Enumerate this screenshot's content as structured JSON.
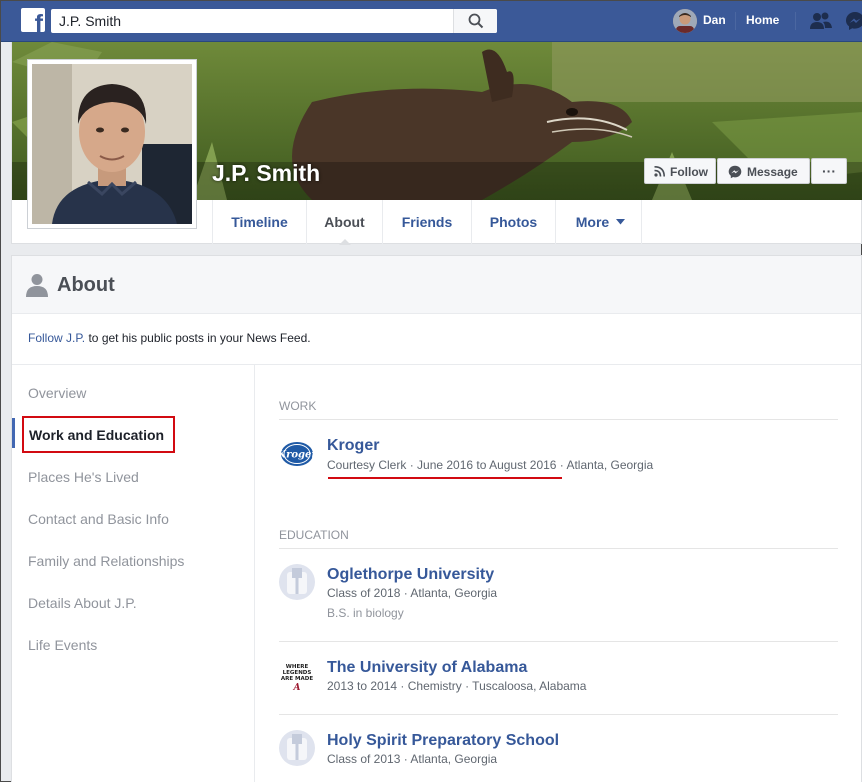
{
  "topbar": {
    "search_value": "J.P. Smith",
    "user_name": "Dan",
    "home_label": "Home"
  },
  "profile": {
    "name": "J.P. Smith",
    "actions": {
      "follow": "Follow",
      "message": "Message",
      "more": "···"
    },
    "tabs": [
      "Timeline",
      "About",
      "Friends",
      "Photos",
      "More"
    ],
    "active_tab": "About"
  },
  "about": {
    "title": "About",
    "follow_link": "Follow J.P.",
    "follow_rest": " to get his public posts in your News Feed.",
    "sidebar": [
      "Overview",
      "Work and Education",
      "Places He's Lived",
      "Contact and Basic Info",
      "Family and Relationships",
      "Details About J.P.",
      "Life Events"
    ],
    "work_label": "Work",
    "work": [
      {
        "name": "Kroger",
        "detail": "Courtesy Clerk · June 2016 to August 2016 · Atlanta, Georgia"
      }
    ],
    "education_label": "Education",
    "education": [
      {
        "name": "Oglethorpe University",
        "detail": "Class of 2018 · Atlanta, Georgia",
        "detail2": "B.S. in biology"
      },
      {
        "name": "The University of Alabama",
        "detail": "2013 to 2014 · Chemistry · Tuscaloosa, Alabama"
      },
      {
        "name": "Holy Spirit Preparatory School",
        "detail": "Class of 2013 · Atlanta, Georgia"
      }
    ],
    "alabama_logo_text": "WHERE LEGENDS ARE MADE"
  },
  "colors": {
    "brand": "#3b5998",
    "link": "#365899",
    "highlight": "#d20a11"
  }
}
